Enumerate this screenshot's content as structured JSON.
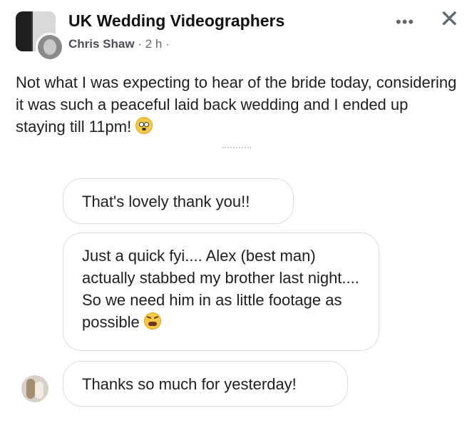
{
  "header": {
    "group_name": "UK Wedding Videographers",
    "author": "Chris Shaw",
    "separator": " · ",
    "time": "2 h",
    "trailing": " ·",
    "more_icon": "more-horizontal-icon",
    "close_icon": "close-icon",
    "more_glyph": "•••",
    "close_glyph": "✕"
  },
  "post": {
    "text": "Not what I was expecting to hear of the bride today, considering it was such a peaceful laid back wedding and I ended up staying till 11pm!",
    "emoji": "flushed-face-icon"
  },
  "messages": [
    {
      "text": "That's lovely thank you!!"
    },
    {
      "text": "Just a quick fyi.... Alex (best man) actually stabbed my brother last night.... So we need him in as little footage as possible",
      "emoji": "weary-face-icon"
    },
    {
      "text": "Thanks so much for yesterday!"
    }
  ],
  "colors": {
    "text": "#1c1e21",
    "meta": "#65676b",
    "bubble_border": "#dcdcdc"
  }
}
